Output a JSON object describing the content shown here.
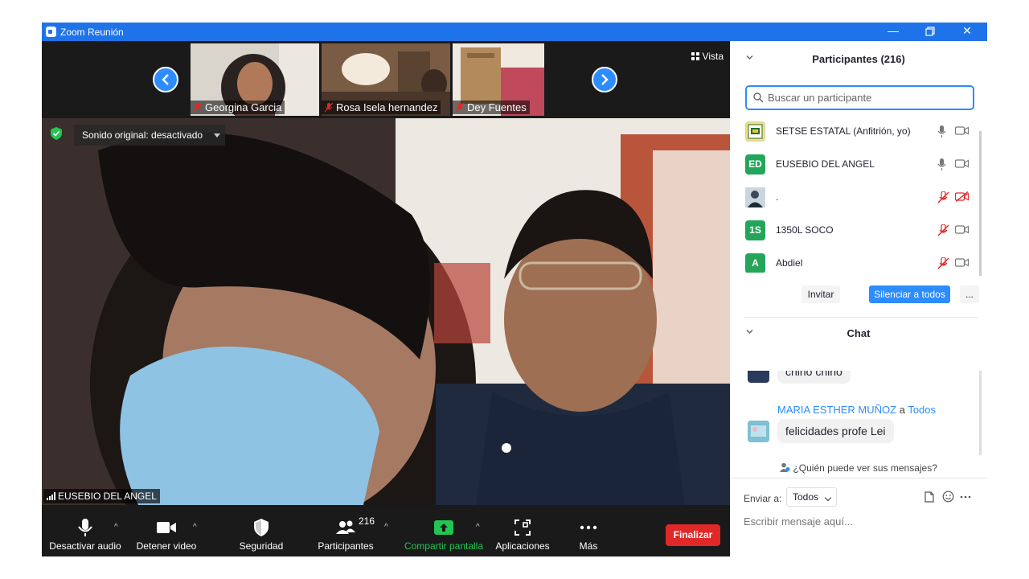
{
  "window": {
    "title": "Zoom Reunión",
    "titlebar_color": "#1f73e8"
  },
  "strip": {
    "view_label": "Vista",
    "participants": [
      {
        "name": "Georgina Garcia"
      },
      {
        "name": "Rosa Isela hernandez"
      },
      {
        "name": "Dey Fuentes"
      }
    ]
  },
  "main_video": {
    "sound_label": "Sonido original: desactivado",
    "speaker_name": "EUSEBIO DEL ANGEL"
  },
  "toolbar": {
    "mute_label": "Desactivar audio",
    "video_label": "Detener video",
    "security_label": "Seguridad",
    "participants_label": "Participantes",
    "participants_count": "216",
    "share_label": "Compartir pantalla",
    "apps_label": "Aplicaciones",
    "more_label": "Más",
    "end_label": "Finalizar",
    "share_color": "#23c552",
    "end_color": "#e02828"
  },
  "participants_panel": {
    "title": "Participantes (216)",
    "search_placeholder": "Buscar un participante",
    "list": [
      {
        "name": "SETSE ESTATAL (Anfitrión, yo)",
        "avatar": "",
        "mic": "mic-icon",
        "cam": "video-icon"
      },
      {
        "name": "EUSEBIO DEL ANGEL",
        "avatar": "ED",
        "mic": "mic-icon",
        "cam": "video-icon"
      },
      {
        "name": ".",
        "avatar": "",
        "mic": "mic-muted-icon",
        "cam": "video-off-icon"
      },
      {
        "name": "1350L SOCO",
        "avatar": "1S",
        "mic": "mic-muted-icon",
        "cam": "video-icon"
      },
      {
        "name": "Abdiel",
        "avatar": "A",
        "mic": "mic-muted-icon",
        "cam": "video-icon"
      }
    ],
    "invite_label": "Invitar",
    "mute_all_label": "Silenciar a todos",
    "more_label": "...",
    "accent": "#2d8cff"
  },
  "chat_panel": {
    "title": "Chat",
    "messages": [
      {
        "text": "chino chino"
      },
      {
        "sender": "MARIA ESTHER MUÑOZ",
        "joiner": "a",
        "recipient": "Todos",
        "text": "felicidades profe Lei"
      }
    ],
    "who_can_see": "¿Quién puede ver sus mensajes?",
    "send_to_label": "Enviar a:",
    "send_to_value": "Todos",
    "input_placeholder": "Escribir mensaje aquí..."
  }
}
